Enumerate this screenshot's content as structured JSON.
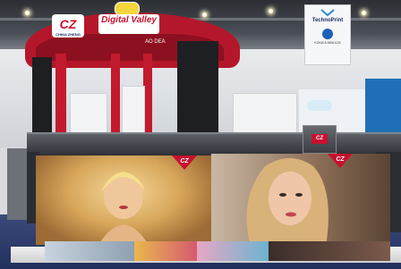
{
  "booth": {
    "logo_text": "CZ",
    "logo_subtext": "CHINA ZHENG",
    "brand_name": "Digital Valley",
    "brand_subtext": "",
    "side_text": "AO DEA"
  },
  "banner": {
    "name": "TechnoPrint",
    "subtext": "",
    "label": "KONICA MINOLTA"
  },
  "printer": {
    "logo_text": "CZ"
  },
  "prints": {
    "corner_text": "CZ"
  }
}
